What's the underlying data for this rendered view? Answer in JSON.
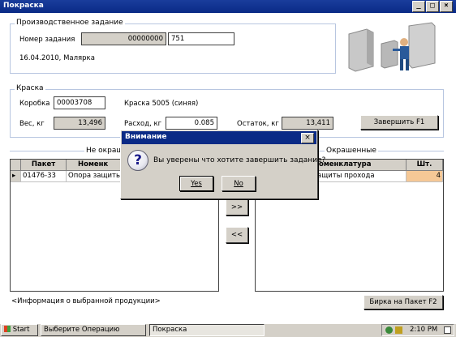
{
  "window": {
    "title": "Покраска"
  },
  "production_task": {
    "legend": "Производственное задание",
    "number_label": "Номер задания",
    "number_prefix": "00000000",
    "number_value": "751",
    "date_operation": "16.04.2010, Малярка"
  },
  "paint": {
    "legend": "Краска",
    "box_label": "Коробка",
    "box_value": "00003708",
    "paint_name": "Краска 5005 (синяя)",
    "weight_label": "Вес, кг",
    "weight_value": "13,496",
    "consumption_label": "Расход, кг",
    "consumption_value": "0.085",
    "remainder_label": "Остаток, кг",
    "remainder_value": "13,411",
    "finish_button": "Завершить    F1"
  },
  "left_panel": {
    "legend": "Не окраш",
    "col_packet": "Пакет",
    "col_nomenclature": "Номенк",
    "rows": [
      {
        "marker": "▸",
        "packet": "01476-33",
        "nomenclature": "Опора защиты про"
      }
    ]
  },
  "right_panel": {
    "legend": "Окрашенные",
    "col_nomenclature": "оменклатура",
    "col_qty": "Шт.",
    "rows": [
      {
        "nomenclature": "ащиты прохода",
        "qty": "4"
      }
    ]
  },
  "transfer": {
    "forward": ">>",
    "back": "<<"
  },
  "info_text": "<Информация о выбранной продукции>",
  "tag_button": "Бирка на Пакет    F2",
  "dialog": {
    "title": "Внимание",
    "close": "×",
    "icon_glyph": "?",
    "message": "Вы уверены что хотите завершить задание?",
    "yes": "Yes",
    "no": "No"
  },
  "taskbar": {
    "start": "Start",
    "tasks": [
      "Выберите Операцию",
      "Покраска"
    ],
    "clock": "2:10 PM"
  },
  "colors": {
    "title_blue": "#0a2a86",
    "qty_highlight": "#f5c896"
  }
}
